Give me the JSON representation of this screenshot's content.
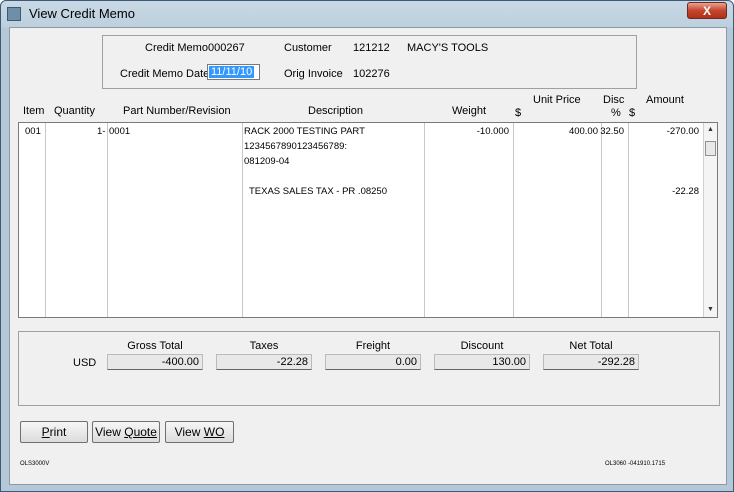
{
  "window": {
    "title": "View Credit Memo",
    "close_label": "X"
  },
  "header": {
    "credit_memo_label": "Credit Memo",
    "credit_memo_value": "000267",
    "customer_label": "Customer",
    "customer_id": "121212",
    "customer_name": "MACY'S TOOLS",
    "date_label": "Credit Memo Date",
    "date_value": "11/11/10",
    "orig_invoice_label": "Orig Invoice",
    "orig_invoice_value": "102276"
  },
  "columns": {
    "item": "Item",
    "quantity": "Quantity",
    "part": "Part Number/Revision",
    "description": "Description",
    "weight": "Weight",
    "dollar1": "$",
    "unit_price": "Unit Price",
    "disc": "Disc",
    "pct": "%",
    "dollar2": "$",
    "amount": "Amount"
  },
  "rows": [
    {
      "item": "001",
      "quantity": "1-",
      "part": "0001",
      "description": [
        "RACK 2000 TESTING PART",
        "1234567890123456789:",
        "081209-04"
      ],
      "weight": "-10.000",
      "unit_price": "400.00",
      "disc": "32.50",
      "amount": "-270.00"
    },
    {
      "description": [
        "TEXAS SALES TAX - PR .08250"
      ],
      "amount": "-22.28"
    }
  ],
  "totals": {
    "currency": "USD",
    "gross_label": "Gross Total",
    "gross": "-400.00",
    "taxes_label": "Taxes",
    "taxes": "-22.28",
    "freight_label": "Freight",
    "freight": "0.00",
    "discount_label": "Discount",
    "discount": "130.00",
    "net_label": "Net Total",
    "net": "-292.28"
  },
  "buttons": {
    "print_u": "P",
    "print_rest": "rint",
    "quote_pre": "View ",
    "quote_u": "Q",
    "quote_rest": "uote",
    "wo_pre": "View ",
    "wo_u": "W",
    "wo_rest": "O"
  },
  "footer": {
    "left_code": "OLS3000V",
    "right_code": "OL3060 -041910.1715"
  }
}
